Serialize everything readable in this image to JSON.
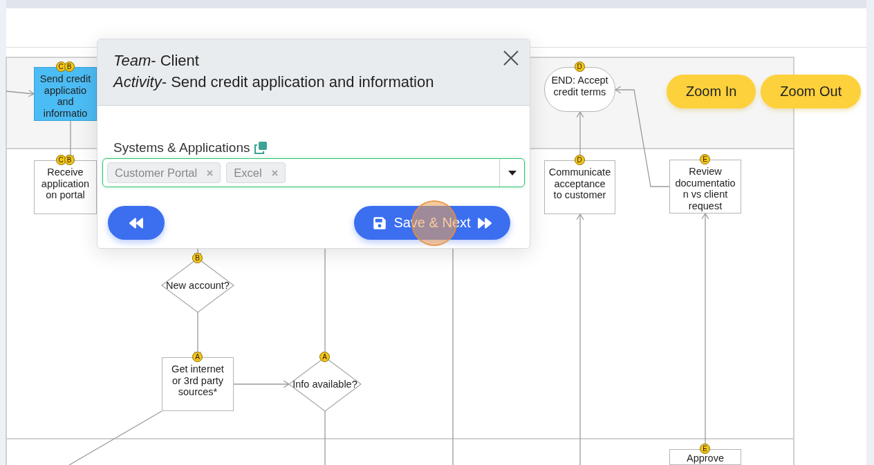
{
  "diagram": {
    "nodes": [
      {
        "kind": "task",
        "selected": true,
        "lines": [
          "Send credit",
          "applicatio",
          "and",
          "informatio"
        ],
        "badges": [
          "C",
          "B"
        ]
      },
      {
        "kind": "task",
        "selected": false,
        "lines": [
          "Receive",
          "application",
          "on portal"
        ],
        "badges": [
          "C",
          "B"
        ]
      },
      {
        "kind": "decision",
        "selected": false,
        "lines": [
          "New account?"
        ],
        "badges": [
          "B"
        ]
      },
      {
        "kind": "task",
        "selected": false,
        "lines": [
          "Get internet",
          "or 3rd party",
          "sources*"
        ],
        "badges": [
          "A"
        ]
      },
      {
        "kind": "decision",
        "selected": false,
        "lines": [
          "Info available?"
        ],
        "badges": [
          "A"
        ]
      },
      {
        "kind": "end",
        "selected": false,
        "lines": [
          "END: Accept",
          "credit terms"
        ],
        "badges": [
          "D"
        ]
      },
      {
        "kind": "task",
        "selected": false,
        "lines": [
          "Communicate",
          "acceptance",
          "to customer"
        ],
        "badges": [
          "D"
        ]
      },
      {
        "kind": "task",
        "selected": false,
        "lines": [
          "Review",
          "documentatio",
          "n vs client",
          "request"
        ],
        "badges": [
          "E"
        ]
      },
      {
        "kind": "task",
        "selected": false,
        "lines": [
          "Approve"
        ],
        "badges": [
          "E"
        ]
      }
    ]
  },
  "zoom_buttons": [
    "Zoom In",
    "Zoom Out"
  ],
  "dialog": {
    "title_lines": [
      "*Team*- Client",
      "*Activity*- Send credit application and information"
    ],
    "field": {
      "label": "Systems & Applications",
      "tags": [
        {
          "label": "Customer Portal"
        },
        {
          "label": "Excel"
        }
      ]
    },
    "save_button": "Save & Next"
  }
}
